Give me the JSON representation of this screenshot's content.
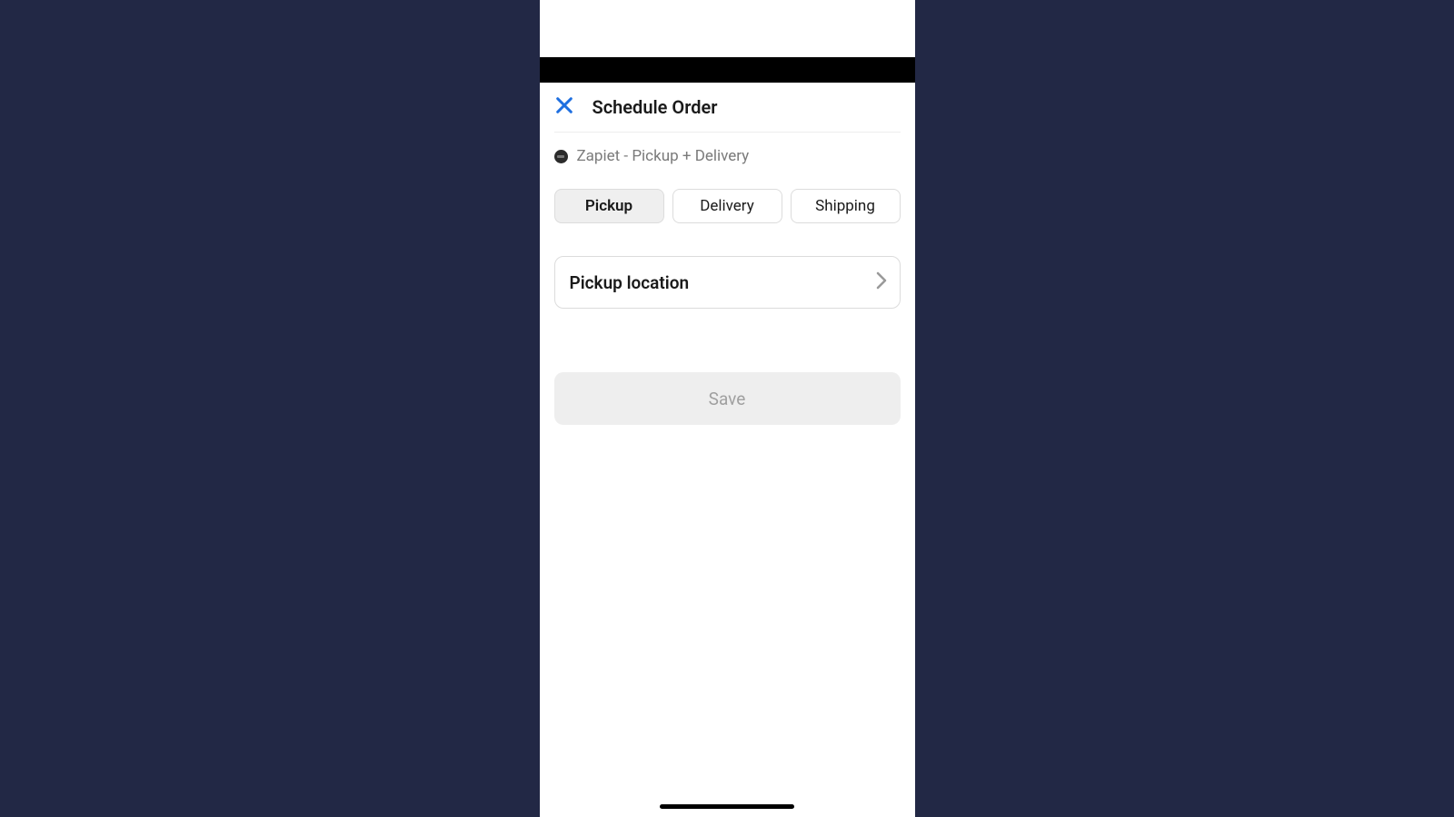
{
  "header": {
    "title": "Schedule Order"
  },
  "app": {
    "name": "Zapiet - Pickup + Delivery"
  },
  "tabs": [
    {
      "label": "Pickup",
      "active": true
    },
    {
      "label": "Delivery",
      "active": false
    },
    {
      "label": "Shipping",
      "active": false
    }
  ],
  "row": {
    "label": "Pickup location"
  },
  "actions": {
    "save": "Save"
  }
}
